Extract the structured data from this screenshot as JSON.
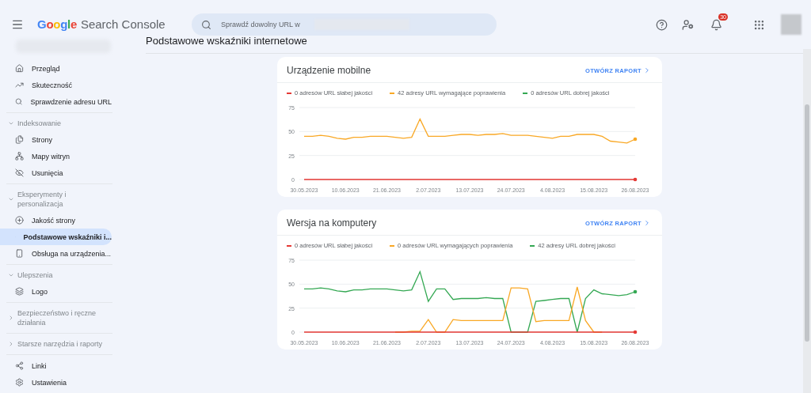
{
  "header": {
    "product": {
      "brand": "Google",
      "name": "Search Console"
    },
    "search": {
      "placeholder": "Sprawdź dowolny URL w"
    },
    "notifications": {
      "count": "30"
    }
  },
  "sidebar": {
    "groups": [
      {
        "items": [
          {
            "label": "Przegląd",
            "selected": false
          },
          {
            "label": "Skuteczność",
            "selected": false
          },
          {
            "label": "Sprawdzenie adresu URL",
            "selected": false
          }
        ]
      },
      {
        "heading": "Indeksowanie",
        "expanded": true,
        "items": [
          {
            "label": "Strony",
            "selected": false
          },
          {
            "label": "Mapy witryn",
            "selected": false
          },
          {
            "label": "Usunięcia",
            "selected": false
          }
        ]
      },
      {
        "heading": "Eksperymenty i personalizacja",
        "expanded": true,
        "items": [
          {
            "label": "Jakość strony",
            "selected": false
          },
          {
            "label": "Podstawowe wskaźniki i...",
            "selected": true
          },
          {
            "label": "Obsługa na urządzenia...",
            "selected": false
          }
        ]
      },
      {
        "heading": "Ulepszenia",
        "expanded": true,
        "items": [
          {
            "label": "Logo",
            "selected": false
          }
        ]
      },
      {
        "heading": "Bezpieczeństwo i ręczne działania",
        "expanded": false
      },
      {
        "heading": "Starsze narzędzia i raporty",
        "expanded": false
      },
      {
        "items": [
          {
            "label": "Linki",
            "selected": false
          },
          {
            "label": "Ustawienia",
            "selected": false
          }
        ]
      }
    ]
  },
  "page": {
    "title": "Podstawowe wskaźniki internetowe"
  },
  "cards": [
    {
      "title": "Urządzenie mobilne",
      "action": "OTWÓRZ RAPORT",
      "chart_data": {
        "type": "line",
        "categories": [
          "30.05.2023",
          null,
          null,
          null,
          null,
          "10.06.2023",
          null,
          null,
          null,
          null,
          "21.06.2023",
          null,
          null,
          null,
          null,
          "2.07.2023",
          null,
          null,
          null,
          null,
          "13.07.2023",
          null,
          null,
          null,
          null,
          "24.07.2023",
          null,
          null,
          null,
          null,
          "4.08.2023",
          null,
          null,
          null,
          null,
          "15.08.2023",
          null,
          null,
          null,
          null,
          "26.08.2023"
        ],
        "ylim": [
          0,
          75
        ],
        "yticks": [
          0,
          25,
          50,
          75
        ],
        "series": [
          {
            "name": "0 adresów URL dobrej jakości",
            "color": "#34a853",
            "values": [
              null,
              null,
              null,
              null,
              null,
              null,
              null,
              null,
              null,
              null,
              null,
              null,
              null,
              null,
              null,
              null,
              null,
              null,
              null,
              null,
              null,
              null,
              null,
              null,
              null,
              null,
              null,
              null,
              null,
              null,
              null,
              null,
              null,
              null,
              null,
              null,
              null,
              null,
              null,
              null,
              null
            ]
          },
          {
            "name": "42 adresy URL wymagające poprawienia",
            "color": "#f9a825",
            "values": [
              45,
              45,
              46,
              45,
              43,
              42,
              44,
              44,
              45,
              45,
              45,
              44,
              43,
              44,
              63,
              45,
              45,
              45,
              46,
              47,
              47,
              46,
              47,
              47,
              48,
              46,
              46,
              46,
              45,
              44,
              43,
              45,
              45,
              47,
              47,
              47,
              45,
              40,
              39,
              38,
              42
            ]
          },
          {
            "name": "0 adresów URL słabej jakości",
            "color": "#e53935",
            "values": [
              0,
              0,
              0,
              0,
              0,
              0,
              0,
              0,
              0,
              0,
              0,
              0,
              0,
              0,
              0,
              0,
              0,
              0,
              0,
              0,
              0,
              0,
              0,
              0,
              0,
              0,
              0,
              0,
              0,
              0,
              0,
              0,
              0,
              0,
              0,
              0,
              0,
              0,
              0,
              0,
              0
            ]
          }
        ]
      }
    },
    {
      "title": "Wersja na komputery",
      "action": "OTWÓRZ RAPORT",
      "chart_data": {
        "type": "line",
        "categories": [
          "30.05.2023",
          null,
          null,
          null,
          null,
          "10.06.2023",
          null,
          null,
          null,
          null,
          "21.06.2023",
          null,
          null,
          null,
          null,
          "2.07.2023",
          null,
          null,
          null,
          null,
          "13.07.2023",
          null,
          null,
          null,
          null,
          "24.07.2023",
          null,
          null,
          null,
          null,
          "4.08.2023",
          null,
          null,
          null,
          null,
          "15.08.2023",
          null,
          null,
          null,
          null,
          "26.08.2023"
        ],
        "ylim": [
          0,
          75
        ],
        "yticks": [
          0,
          25,
          50,
          75
        ],
        "series": [
          {
            "name": "42 adresy URL dobrej jakości",
            "color": "#34a853",
            "values": [
              45,
              45,
              46,
              45,
              43,
              42,
              44,
              44,
              45,
              45,
              45,
              44,
              43,
              44,
              63,
              32,
              45,
              45,
              34,
              35,
              35,
              35,
              36,
              35,
              35,
              0,
              0,
              0,
              32,
              33,
              34,
              35,
              35,
              0,
              35,
              44,
              40,
              39,
              38,
              39,
              42
            ]
          },
          {
            "name": "0 adresów URL wymagających poprawienia",
            "color": "#f9a825",
            "values": [
              null,
              null,
              null,
              null,
              null,
              null,
              null,
              null,
              null,
              null,
              null,
              0,
              0,
              1,
              1,
              13,
              0,
              0,
              13,
              12,
              12,
              12,
              12,
              12,
              12,
              46,
              46,
              45,
              11,
              12,
              12,
              12,
              12,
              47,
              12,
              0,
              0,
              null,
              null,
              null,
              null
            ]
          },
          {
            "name": "0 adresów URL słabej jakości",
            "color": "#e53935",
            "values": [
              0,
              0,
              0,
              0,
              0,
              0,
              0,
              0,
              0,
              0,
              0,
              0,
              0,
              0,
              0,
              0,
              0,
              0,
              0,
              0,
              0,
              0,
              0,
              0,
              0,
              0,
              0,
              0,
              0,
              0,
              0,
              0,
              0,
              0,
              0,
              0,
              0,
              0,
              0,
              0,
              0
            ]
          }
        ]
      }
    }
  ]
}
